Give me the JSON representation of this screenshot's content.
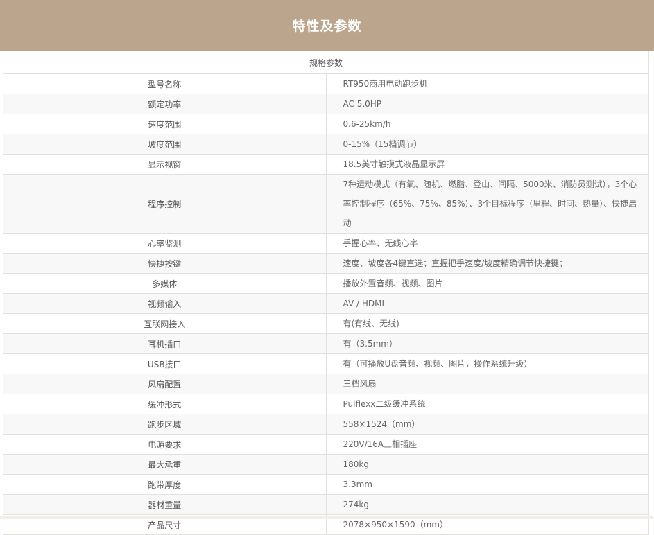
{
  "header": {
    "title": "特性及参数"
  },
  "table": {
    "caption": "规格参数",
    "rows": [
      {
        "label": "型号名称",
        "value": "RT950商用电动跑步机"
      },
      {
        "label": "额定功率",
        "value": "AC 5.0HP"
      },
      {
        "label": "速度范围",
        "value": "0.6-25km/h"
      },
      {
        "label": "坡度范围",
        "value": "0-15%（15档调节）"
      },
      {
        "label": "显示视窗",
        "value": "18.5英寸触摸式液晶显示屏"
      },
      {
        "label": "程序控制",
        "value": "7种运动模式（有氧、随机、燃脂、登山、间隔、5000米、消防员测试），3个心率控制程序（65%、75%、85%）、3个目标程序（里程、时间、热量）、快捷启动"
      },
      {
        "label": "心率监测",
        "value": "手握心率、无线心率"
      },
      {
        "label": "快捷按键",
        "value": "速度、坡度各4键直选；直握把手速度/坡度精确调节快捷键；"
      },
      {
        "label": "多媒体",
        "value": "播放外置音频、视频、图片"
      },
      {
        "label": "视频输入",
        "value": "AV / HDMI"
      },
      {
        "label": "互联网接入",
        "value": "有(有线、无线)"
      },
      {
        "label": "耳机插口",
        "value": "有（3.5mm）"
      },
      {
        "label": "USB接口",
        "value": "有（可播放U盘音频、视频、图片，操作系统升级）"
      },
      {
        "label": "风扇配置",
        "value": "三档风扇"
      },
      {
        "label": "缓冲形式",
        "value": "Pulflexx二级缓冲系统"
      },
      {
        "label": "跑步区域",
        "value": "558×1524（mm）"
      },
      {
        "label": "电源要求",
        "value": "220V/16A三相插座"
      },
      {
        "label": "最大承重",
        "value": "180kg"
      },
      {
        "label": "跑带厚度",
        "value": "3.3mm"
      },
      {
        "label": "器材重量",
        "value": "274kg"
      },
      {
        "label": "产品尺寸",
        "value": "2078×950×1590（mm）"
      }
    ]
  }
}
